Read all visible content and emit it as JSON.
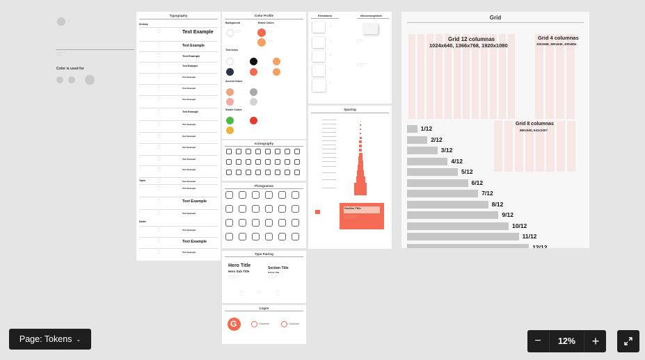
{
  "page_selector": {
    "label": "Page: Tokens"
  },
  "zoom": {
    "value": "12%",
    "minus_label": "−",
    "plus_label": "+"
  },
  "canvas": {
    "misc": {
      "color_heading": "Color is used for"
    },
    "typography": {
      "title": "Typography",
      "sections": [
        "Desktop",
        "Tablet",
        "Mobile"
      ],
      "example": "Text Example"
    },
    "color_profile": {
      "title": "Color Profile",
      "background": "Background",
      "brand_colors": "Brand Colors",
      "text_tones": "Text-tones",
      "accent_colors": "Accent Colors",
      "status_colors": "Status Colors"
    },
    "elevations": {
      "title": "Elevations"
    },
    "neumorphism": {
      "title": "Neuromorphism"
    },
    "spacing": {
      "title": "Spacing",
      "section_title": "Section Title"
    },
    "iconography": {
      "title": "Iconography"
    },
    "pictograms": {
      "title": "Pictogramas"
    },
    "type_pairing": {
      "title": "Type Pairing",
      "hero_title": "Hero Title",
      "hero_sub": "Hero Sub Title",
      "section_title": "Section Title",
      "article": "Article Title"
    },
    "logos": {
      "title": "Logos",
      "wordmark": "Goulooot"
    },
    "grid": {
      "title": "Grid",
      "grid12_title": "Grid 12 columnas",
      "grid12_sizes": "1024x640, 1366x768, 1920x1080",
      "grid4_title": "Grid 4 columnas",
      "grid4_sizes": "320x568, 360x640, 400x854",
      "grid8_title": "Grid 8 columnas",
      "grid8_sizes": "960x540, 641x1007",
      "fractions": [
        "1/12",
        "2/12",
        "3/12",
        "4/12",
        "5/12",
        "6/12",
        "7/12",
        "8/12",
        "9/12",
        "10/12",
        "11/12",
        "12/12"
      ]
    }
  },
  "colors": {
    "accent": "#f46a55",
    "brand1": "#f26a50",
    "brand2": "#f4a060",
    "dark": "#2e3246",
    "green": "#4cbb47",
    "red": "#e83a2e",
    "yellow": "#e8b53a"
  }
}
